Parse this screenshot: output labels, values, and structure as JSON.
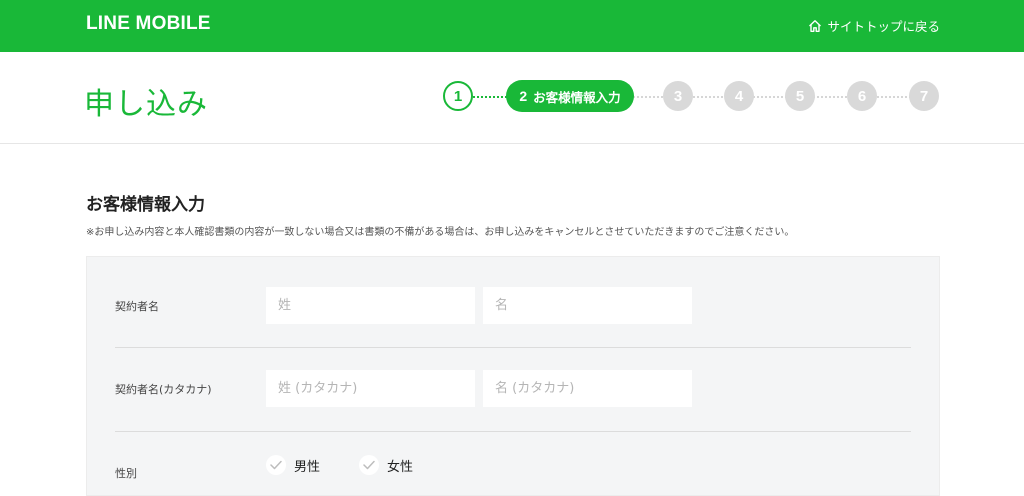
{
  "header": {
    "logo": "LINE MOBILE",
    "back_link": "サイトトップに戻る",
    "back_icon": "home-icon",
    "brand_color": "#19b838"
  },
  "page": {
    "title": "申し込み"
  },
  "steps": {
    "done": "1",
    "current_num": "2",
    "current_label": "お客様情報入力",
    "upcoming": [
      "3",
      "4",
      "5",
      "6",
      "7"
    ]
  },
  "section": {
    "title": "お客様情報入力",
    "note": "※お申し込み内容と本人確認書類の内容が一致しない場合又は書類の不備がある場合は、お申し込みをキャンセルとさせていただきますのでご注意ください。"
  },
  "form": {
    "name_label": "契約者名",
    "last_name_placeholder": "姓",
    "first_name_placeholder": "名",
    "kana_label": "契約者名(カタカナ)",
    "last_kana_placeholder": "姓 (カタカナ)",
    "first_kana_placeholder": "名 (カタカナ)",
    "gender_label": "性別",
    "gender_options": [
      "男性",
      "女性"
    ],
    "check_icon": "check-icon"
  }
}
